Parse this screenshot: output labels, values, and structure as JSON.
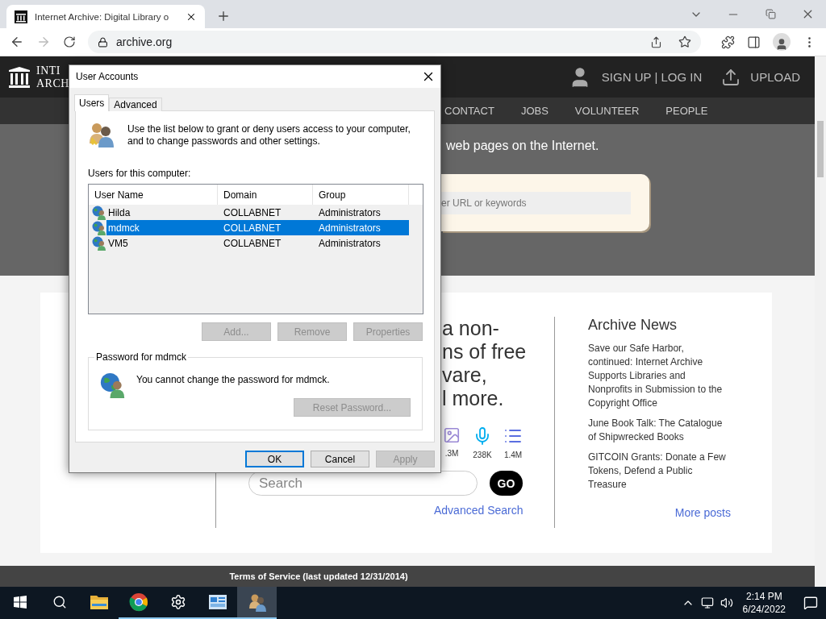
{
  "browser": {
    "tabs": [
      {
        "title": "Internet Archive: Digital Library o",
        "selected": true
      }
    ],
    "address": "archive.org",
    "forward_disabled": true
  },
  "site": {
    "logo_lines": [
      "INTI",
      "ARCH"
    ],
    "account_link": "SIGN UP | LOG IN",
    "upload": "UPLOAD",
    "nav": [
      "CONTACT",
      "JOBS",
      "VOLUNTEER",
      "PEOPLE"
    ],
    "hero_text": "web pages on the Internet.",
    "url_placeholder": "er URL or keywords",
    "intro_lines": [
      "a non-",
      "ns of free",
      "vare,",
      "l more."
    ],
    "media_counts": [
      {
        "kind": "image",
        "count": ".3M"
      },
      {
        "kind": "audio",
        "count": "238K"
      },
      {
        "kind": "list",
        "count": "1.4M"
      }
    ],
    "search": {
      "placeholder": "Search",
      "button": "GO"
    },
    "advanced_search": "Advanced Search",
    "news": {
      "title": "Archive News",
      "items": [
        "Save our Safe Harbor, continued: Internet Archive Supports Libraries and Nonprofits in Submission to the Copyright Office",
        "June Book Talk: The Catalogue of Shipwrecked Books",
        "GITCOIN Grants: Donate a Few Tokens, Defend a Public Treasure"
      ],
      "more": "More posts"
    },
    "footer": "Terms of Service (last updated 12/31/2014)"
  },
  "dialog": {
    "title": "User Accounts",
    "tabs": [
      {
        "label": "Users",
        "selected": true
      },
      {
        "label": "Advanced",
        "selected": false
      }
    ],
    "intro": "Use the list below to grant or deny users access to your computer, and to change passwords and other settings.",
    "list_label": "Users for this computer:",
    "columns": [
      "User Name",
      "Domain",
      "Group"
    ],
    "rows": [
      {
        "user": "Hilda",
        "domain": "COLLABNET",
        "group": "Administrators",
        "selected": false
      },
      {
        "user": "mdmck",
        "domain": "COLLABNET",
        "group": "Administrators",
        "selected": true
      },
      {
        "user": "VM5",
        "domain": "COLLABNET",
        "group": "Administrators",
        "selected": false
      }
    ],
    "list_buttons": [
      {
        "label": "Add...",
        "disabled": true
      },
      {
        "label": "Remove",
        "disabled": true
      },
      {
        "label": "Properties",
        "disabled": true
      }
    ],
    "password": {
      "legend": "Password for mdmck",
      "message": "You cannot change the password for mdmck.",
      "button": {
        "label": "Reset Password...",
        "disabled": true
      }
    },
    "footer_buttons": [
      {
        "label": "OK",
        "default": true,
        "disabled": false
      },
      {
        "label": "Cancel",
        "default": false,
        "disabled": false
      },
      {
        "label": "Apply",
        "default": false,
        "disabled": true
      }
    ]
  },
  "taskbar": {
    "apps": [
      {
        "kind": "start",
        "running": false,
        "active": false
      },
      {
        "kind": "search",
        "running": false,
        "active": false
      },
      {
        "kind": "folder",
        "running": false,
        "active": false
      },
      {
        "kind": "browser",
        "running": true,
        "active": false
      },
      {
        "kind": "settings",
        "running": true,
        "active": false
      },
      {
        "kind": "control-panel",
        "running": true,
        "active": false
      },
      {
        "kind": "user-accounts",
        "running": true,
        "active": true
      }
    ],
    "time": "2:14 PM",
    "date": "6/24/2022"
  }
}
